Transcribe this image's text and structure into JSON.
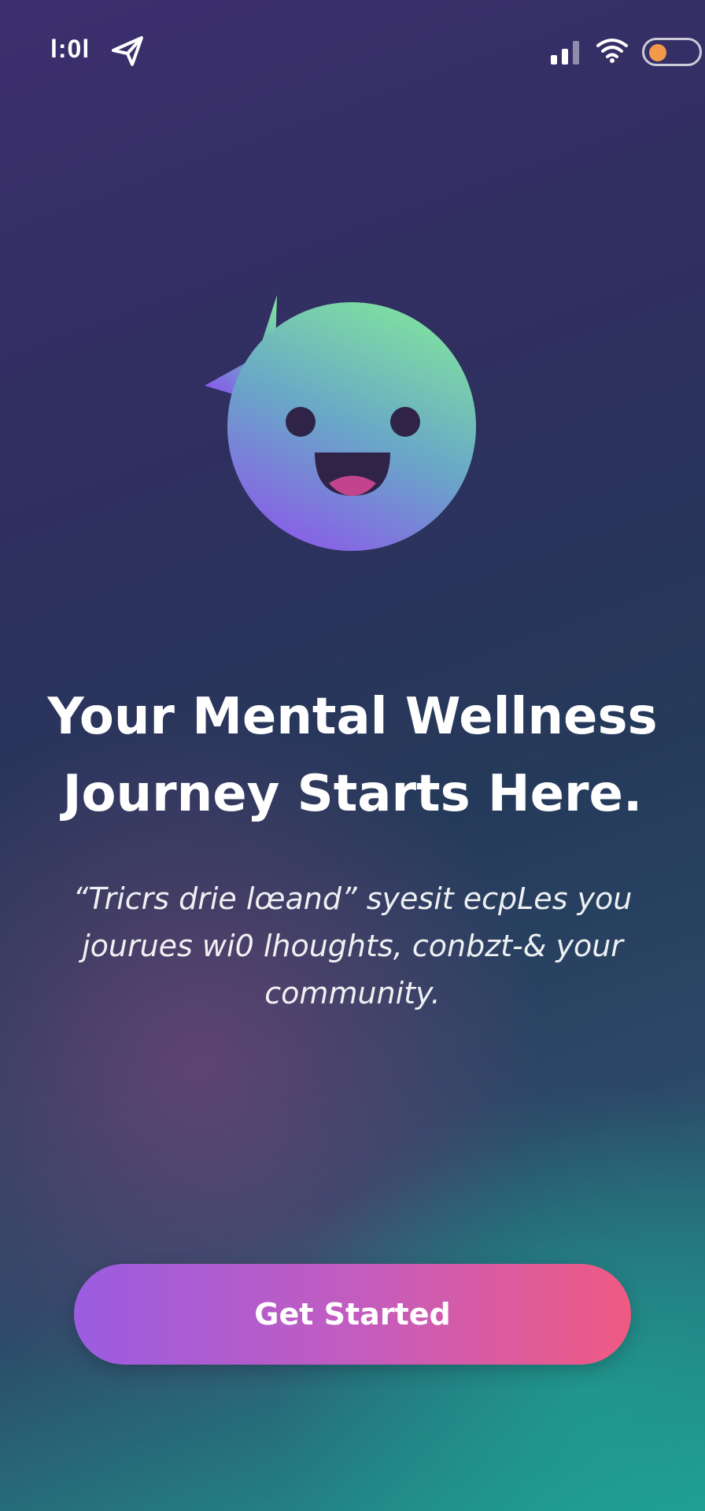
{
  "status_bar": {
    "time": "l:0l",
    "icons": [
      "send-icon",
      "signal-icon",
      "wifi-icon",
      "toggle-switch"
    ],
    "toggle_color": "#f2994a"
  },
  "mascot": {
    "icon": "smiling-chat-bubble-icon"
  },
  "welcome": {
    "headline": "Your Mental Wellness Journey Starts Here.",
    "subtext": "“Tricrs drie lœand” syesit ecpLes you jourues wi0 lhoughts, conbzt-& your community."
  },
  "cta": {
    "label": "Get Started"
  },
  "colors": {
    "button_start": "#9b5ce0",
    "button_end": "#f05a82",
    "mascot_top": "#7fe0a0",
    "mascot_bottom": "#8a5ce8"
  }
}
